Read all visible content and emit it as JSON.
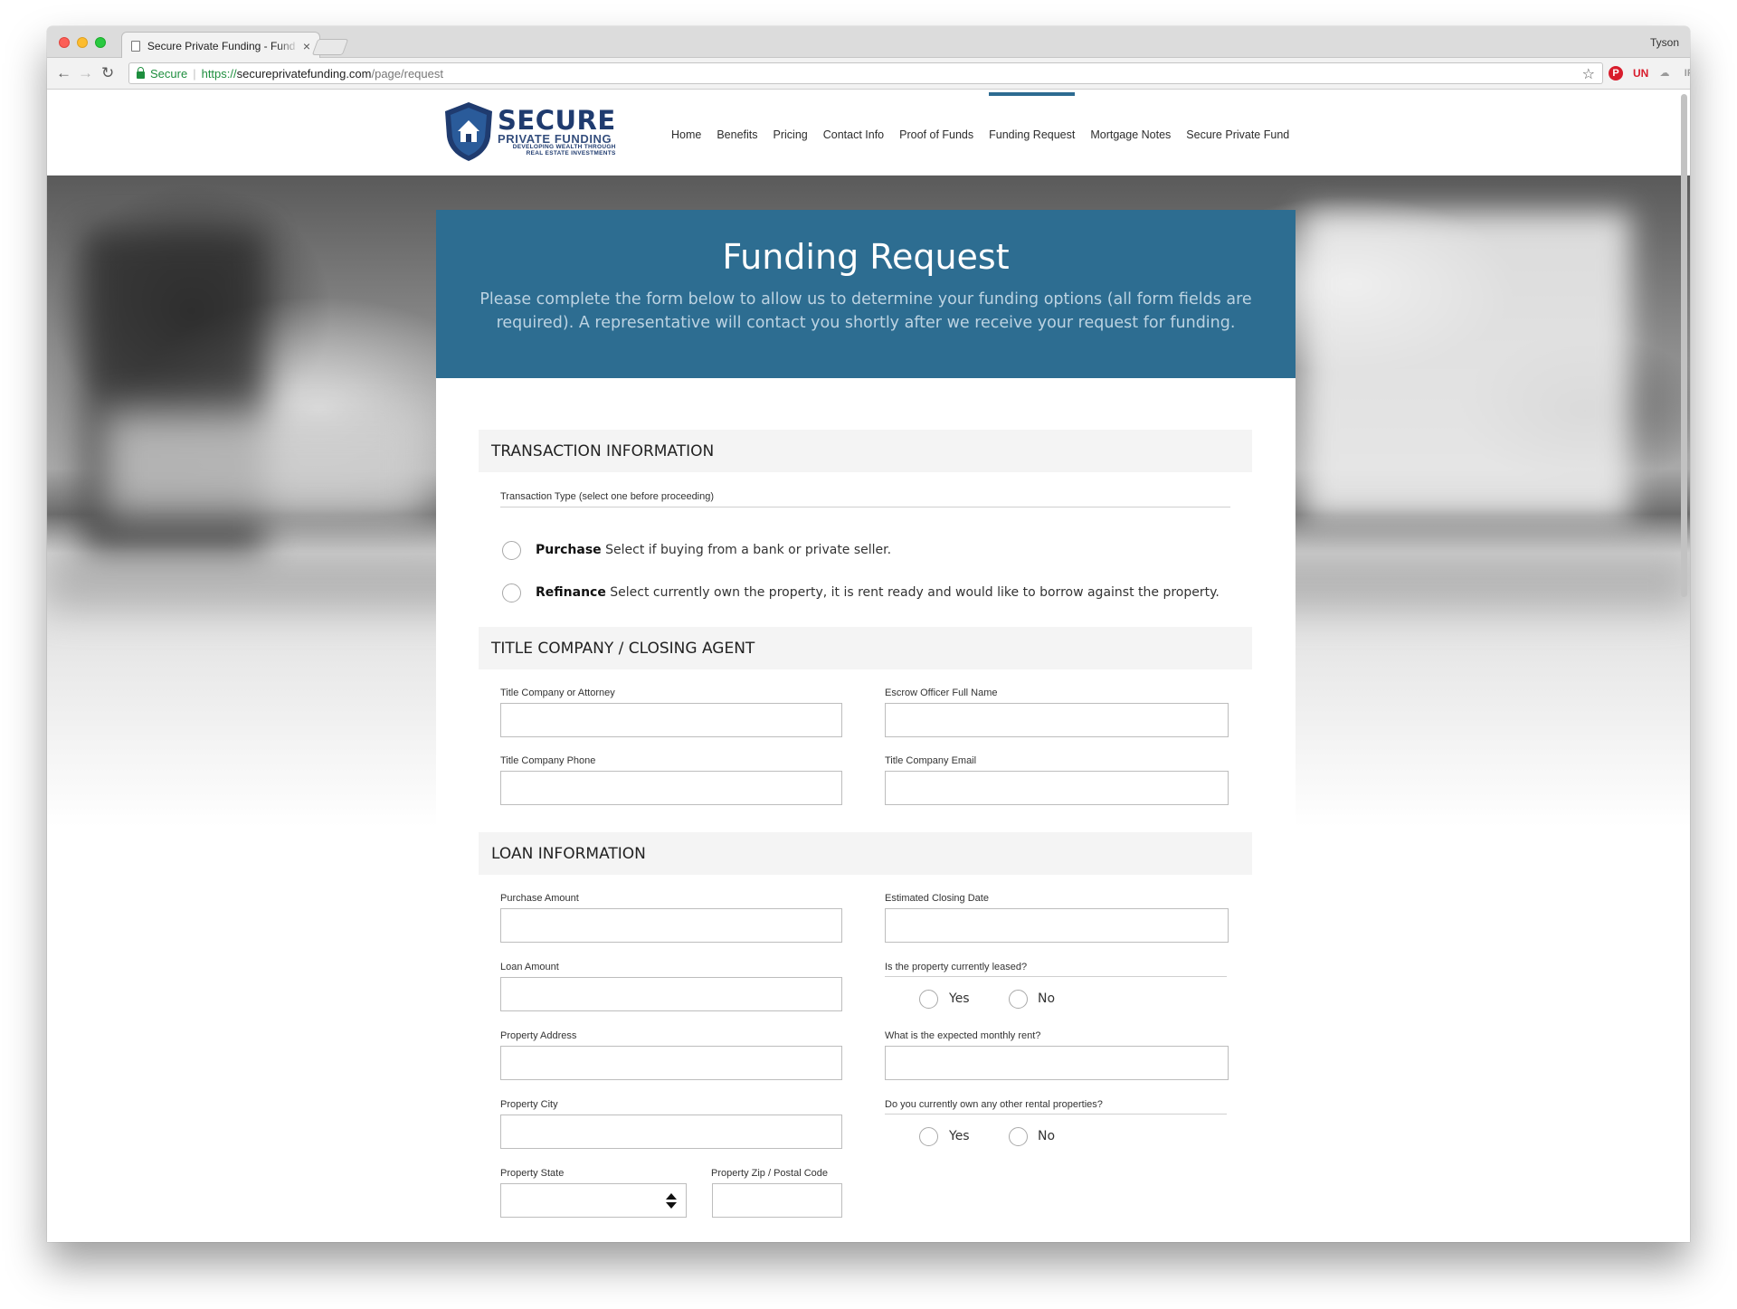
{
  "browser": {
    "tab_title": "Secure Private Funding - Fund",
    "profile_name": "Tyson",
    "secure_label": "Secure",
    "url_scheme": "https://",
    "url_host": "secureprivatefunding.com",
    "url_path": "/page/request"
  },
  "site": {
    "logo_main": "SECURE",
    "logo_sub": "PRIVATE FUNDING",
    "logo_tag1": "DEVELOPING WEALTH THROUGH",
    "logo_tag2": "REAL ESTATE INVESTMENTS",
    "nav": [
      {
        "label": "Home"
      },
      {
        "label": "Benefits"
      },
      {
        "label": "Pricing"
      },
      {
        "label": "Contact Info"
      },
      {
        "label": "Proof of Funds"
      },
      {
        "label": "Funding Request",
        "active": true
      },
      {
        "label": "Mortgage Notes"
      },
      {
        "label": "Secure Private Fund"
      }
    ],
    "accent_color": "#2d6d91"
  },
  "form": {
    "title": "Funding Request",
    "description": "Please complete the form below to allow us to determine your funding options (all form fields are required). A representative will contact you shortly after we receive your request for funding.",
    "transaction": {
      "heading": "TRANSACTION INFORMATION",
      "type_label": "Transaction Type (select one before proceeding)",
      "purchase_bold": "Purchase",
      "purchase_text": " Select if buying from a bank or private seller.",
      "refinance_bold": "Refinance",
      "refinance_text": " Select currently own the property, it is rent ready and would like to borrow against the property."
    },
    "title_company": {
      "heading": "TITLE COMPANY / CLOSING AGENT",
      "company_label": "Title Company or Attorney",
      "escrow_label": "Escrow Officer Full Name",
      "phone_label": "Title Company Phone",
      "email_label": "Title Company Email"
    },
    "loan": {
      "heading": "LOAN INFORMATION",
      "purchase_amount_label": "Purchase Amount",
      "closing_date_label": "Estimated Closing Date",
      "loan_amount_label": "Loan Amount",
      "leased_label": "Is the property currently leased?",
      "address_label": "Property Address",
      "rent_label": "What is the expected monthly rent?",
      "city_label": "Property City",
      "other_rentals_label": "Do you currently own any other rental properties?",
      "state_label": "Property State",
      "zip_label": "Property Zip / Postal Code",
      "yes_label": "Yes",
      "no_label": "No"
    }
  }
}
